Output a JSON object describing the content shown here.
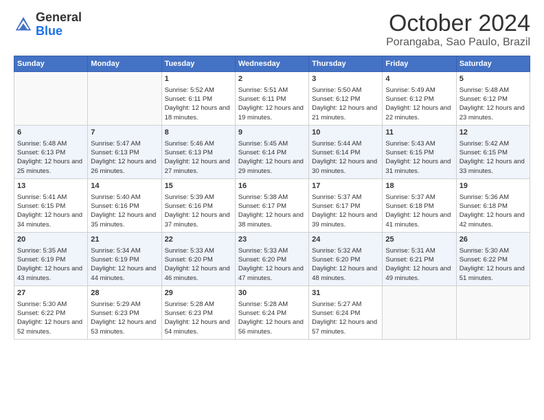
{
  "logo": {
    "general": "General",
    "blue": "Blue"
  },
  "header": {
    "title": "October 2024",
    "subtitle": "Porangaba, Sao Paulo, Brazil"
  },
  "weekdays": [
    "Sunday",
    "Monday",
    "Tuesday",
    "Wednesday",
    "Thursday",
    "Friday",
    "Saturday"
  ],
  "weeks": [
    [
      {
        "day": "",
        "sunrise": "",
        "sunset": "",
        "daylight": ""
      },
      {
        "day": "",
        "sunrise": "",
        "sunset": "",
        "daylight": ""
      },
      {
        "day": "1",
        "sunrise": "Sunrise: 5:52 AM",
        "sunset": "Sunset: 6:11 PM",
        "daylight": "Daylight: 12 hours and 18 minutes."
      },
      {
        "day": "2",
        "sunrise": "Sunrise: 5:51 AM",
        "sunset": "Sunset: 6:11 PM",
        "daylight": "Daylight: 12 hours and 19 minutes."
      },
      {
        "day": "3",
        "sunrise": "Sunrise: 5:50 AM",
        "sunset": "Sunset: 6:12 PM",
        "daylight": "Daylight: 12 hours and 21 minutes."
      },
      {
        "day": "4",
        "sunrise": "Sunrise: 5:49 AM",
        "sunset": "Sunset: 6:12 PM",
        "daylight": "Daylight: 12 hours and 22 minutes."
      },
      {
        "day": "5",
        "sunrise": "Sunrise: 5:48 AM",
        "sunset": "Sunset: 6:12 PM",
        "daylight": "Daylight: 12 hours and 23 minutes."
      }
    ],
    [
      {
        "day": "6",
        "sunrise": "Sunrise: 5:48 AM",
        "sunset": "Sunset: 6:13 PM",
        "daylight": "Daylight: 12 hours and 25 minutes."
      },
      {
        "day": "7",
        "sunrise": "Sunrise: 5:47 AM",
        "sunset": "Sunset: 6:13 PM",
        "daylight": "Daylight: 12 hours and 26 minutes."
      },
      {
        "day": "8",
        "sunrise": "Sunrise: 5:46 AM",
        "sunset": "Sunset: 6:13 PM",
        "daylight": "Daylight: 12 hours and 27 minutes."
      },
      {
        "day": "9",
        "sunrise": "Sunrise: 5:45 AM",
        "sunset": "Sunset: 6:14 PM",
        "daylight": "Daylight: 12 hours and 29 minutes."
      },
      {
        "day": "10",
        "sunrise": "Sunrise: 5:44 AM",
        "sunset": "Sunset: 6:14 PM",
        "daylight": "Daylight: 12 hours and 30 minutes."
      },
      {
        "day": "11",
        "sunrise": "Sunrise: 5:43 AM",
        "sunset": "Sunset: 6:15 PM",
        "daylight": "Daylight: 12 hours and 31 minutes."
      },
      {
        "day": "12",
        "sunrise": "Sunrise: 5:42 AM",
        "sunset": "Sunset: 6:15 PM",
        "daylight": "Daylight: 12 hours and 33 minutes."
      }
    ],
    [
      {
        "day": "13",
        "sunrise": "Sunrise: 5:41 AM",
        "sunset": "Sunset: 6:15 PM",
        "daylight": "Daylight: 12 hours and 34 minutes."
      },
      {
        "day": "14",
        "sunrise": "Sunrise: 5:40 AM",
        "sunset": "Sunset: 6:16 PM",
        "daylight": "Daylight: 12 hours and 35 minutes."
      },
      {
        "day": "15",
        "sunrise": "Sunrise: 5:39 AM",
        "sunset": "Sunset: 6:16 PM",
        "daylight": "Daylight: 12 hours and 37 minutes."
      },
      {
        "day": "16",
        "sunrise": "Sunrise: 5:38 AM",
        "sunset": "Sunset: 6:17 PM",
        "daylight": "Daylight: 12 hours and 38 minutes."
      },
      {
        "day": "17",
        "sunrise": "Sunrise: 5:37 AM",
        "sunset": "Sunset: 6:17 PM",
        "daylight": "Daylight: 12 hours and 39 minutes."
      },
      {
        "day": "18",
        "sunrise": "Sunrise: 5:37 AM",
        "sunset": "Sunset: 6:18 PM",
        "daylight": "Daylight: 12 hours and 41 minutes."
      },
      {
        "day": "19",
        "sunrise": "Sunrise: 5:36 AM",
        "sunset": "Sunset: 6:18 PM",
        "daylight": "Daylight: 12 hours and 42 minutes."
      }
    ],
    [
      {
        "day": "20",
        "sunrise": "Sunrise: 5:35 AM",
        "sunset": "Sunset: 6:19 PM",
        "daylight": "Daylight: 12 hours and 43 minutes."
      },
      {
        "day": "21",
        "sunrise": "Sunrise: 5:34 AM",
        "sunset": "Sunset: 6:19 PM",
        "daylight": "Daylight: 12 hours and 44 minutes."
      },
      {
        "day": "22",
        "sunrise": "Sunrise: 5:33 AM",
        "sunset": "Sunset: 6:20 PM",
        "daylight": "Daylight: 12 hours and 46 minutes."
      },
      {
        "day": "23",
        "sunrise": "Sunrise: 5:33 AM",
        "sunset": "Sunset: 6:20 PM",
        "daylight": "Daylight: 12 hours and 47 minutes."
      },
      {
        "day": "24",
        "sunrise": "Sunrise: 5:32 AM",
        "sunset": "Sunset: 6:20 PM",
        "daylight": "Daylight: 12 hours and 48 minutes."
      },
      {
        "day": "25",
        "sunrise": "Sunrise: 5:31 AM",
        "sunset": "Sunset: 6:21 PM",
        "daylight": "Daylight: 12 hours and 49 minutes."
      },
      {
        "day": "26",
        "sunrise": "Sunrise: 5:30 AM",
        "sunset": "Sunset: 6:22 PM",
        "daylight": "Daylight: 12 hours and 51 minutes."
      }
    ],
    [
      {
        "day": "27",
        "sunrise": "Sunrise: 5:30 AM",
        "sunset": "Sunset: 6:22 PM",
        "daylight": "Daylight: 12 hours and 52 minutes."
      },
      {
        "day": "28",
        "sunrise": "Sunrise: 5:29 AM",
        "sunset": "Sunset: 6:23 PM",
        "daylight": "Daylight: 12 hours and 53 minutes."
      },
      {
        "day": "29",
        "sunrise": "Sunrise: 5:28 AM",
        "sunset": "Sunset: 6:23 PM",
        "daylight": "Daylight: 12 hours and 54 minutes."
      },
      {
        "day": "30",
        "sunrise": "Sunrise: 5:28 AM",
        "sunset": "Sunset: 6:24 PM",
        "daylight": "Daylight: 12 hours and 56 minutes."
      },
      {
        "day": "31",
        "sunrise": "Sunrise: 5:27 AM",
        "sunset": "Sunset: 6:24 PM",
        "daylight": "Daylight: 12 hours and 57 minutes."
      },
      {
        "day": "",
        "sunrise": "",
        "sunset": "",
        "daylight": ""
      },
      {
        "day": "",
        "sunrise": "",
        "sunset": "",
        "daylight": ""
      }
    ]
  ]
}
